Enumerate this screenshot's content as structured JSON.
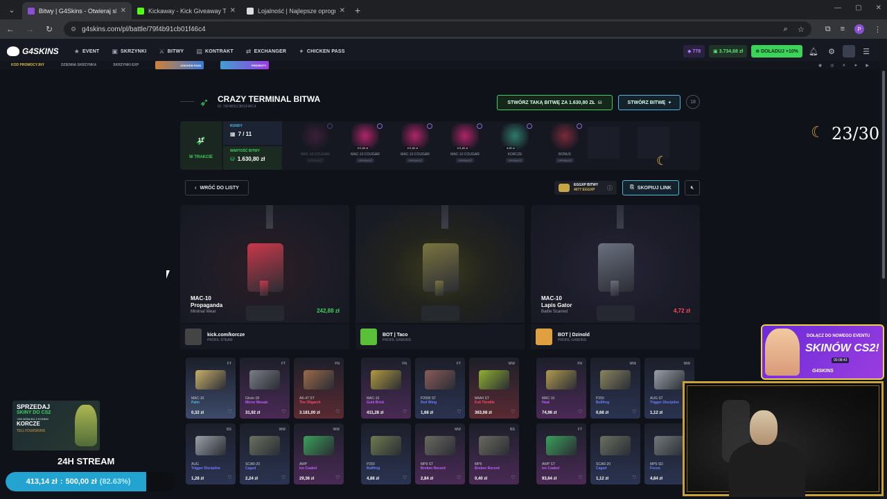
{
  "browser": {
    "tabs": [
      {
        "title": "Bitwy | G4Skins - Otwieraj skrzynki",
        "active": true,
        "color": "#8a4fd6"
      },
      {
        "title": "Kickaway - Kick Giveaway Tool",
        "active": false,
        "color": "#53fc18"
      },
      {
        "title": "Lojalność | Najlepsze oprogramowanie",
        "active": false,
        "color": "#dddddd"
      }
    ],
    "url": "g4skins.com/pl/battle/79f4b91cb01f46c4",
    "profile_initial": "P"
  },
  "header": {
    "logo": "G4SKINS",
    "nav": [
      {
        "label": "EVENT",
        "icon": "star-icon"
      },
      {
        "label": "SKRZYNKI",
        "icon": "box-icon"
      },
      {
        "label": "BITWY",
        "icon": "swords-icon"
      },
      {
        "label": "KONTRAKT",
        "icon": "contract-icon"
      },
      {
        "label": "EXCHANGER",
        "icon": "exchange-icon"
      },
      {
        "label": "CHICKEN PASS",
        "icon": "chicken-icon"
      }
    ],
    "points": "778",
    "balance": "3.734,68 zł",
    "topup_label": "DOŁADUJ +10%"
  },
  "subnav": {
    "items": [
      "KOD PROMOCYJNY",
      "DZIENNA SKRZYNKA",
      "SKRZYNKI EXP"
    ],
    "banner1": "CHICKEN PASS",
    "banner2": "PREZENTY"
  },
  "battle": {
    "title": "CRAZY TERMINAL BITWA",
    "id": "ID: 79F4B91CB01F46C4",
    "create_same_label": "STWÓRZ TAKĄ BITWĘ ZA 1.630,80 ZŁ",
    "create_label": "STWÓRZ BITWĘ",
    "age": "18",
    "status_count": "11",
    "status_label": "W TRAKCIE",
    "rounds_label": "RUNDY",
    "rounds_value": "7 / 11",
    "value_label": "WARTOŚĆ BITWY",
    "value_value": "1.630,80 zł",
    "rounds": [
      {
        "name": "MAC-10 COUGAR",
        "price": "",
        "btn": "SPRAWDŹ",
        "color": "#6a2a55",
        "faded": true
      },
      {
        "name": "MAC-10 COUGAR",
        "price": "101,60 zł",
        "btn": "SPRAWDŹ",
        "color": "#b0246a",
        "faded": false
      },
      {
        "name": "MAC-10 COUGAR",
        "price": "101,60 zł",
        "btn": "SPRAWDŹ",
        "color": "#b0246a",
        "faded": false
      },
      {
        "name": "MAC-10 COUGAR",
        "price": "101,60 zł",
        "btn": "SPRAWDŹ",
        "color": "#b0246a",
        "faded": false
      },
      {
        "name": "KORCZE",
        "price": "8,80 zł",
        "btn": "SPRAWDŹ",
        "color": "#2f7a6a",
        "faded": false
      },
      {
        "name": "BONUS",
        "price": "",
        "btn": "SPRAWDŹ",
        "color": "#7a2a3a",
        "faded": false
      }
    ],
    "back_label": "WRÓĆ DO LISTY",
    "eggxp_label": "EGGXP BITWY",
    "eggxp_value": "4077 EGGXP",
    "copy_label": "SKOPIUJ LINK"
  },
  "players": [
    {
      "drop": {
        "weapon": "MAC-10",
        "skin": "Propaganda",
        "wear": "Minimal Wear",
        "price": "242,88 zł",
        "price_color": "#3cd35a",
        "gun_color": "#c8384a",
        "bg": "red"
      },
      "name": "kick.com/korcze",
      "role": "PROFIL STEAM",
      "avatar": "#444",
      "items": [
        {
          "cond": "FT",
          "weapon": "MAC-10",
          "skin": "Palm",
          "price": "0,32 zł",
          "rarity": "#3d4a6a",
          "skin_color": "#4fb8e0",
          "img": "#c8b06a"
        },
        {
          "cond": "FT",
          "weapon": "Glock-18",
          "skin": "Mirror Mosaic",
          "price": "31,92 zł",
          "rarity": "#4a2a55",
          "skin_color": "#c060ff",
          "img": "#7a7d86"
        },
        {
          "cond": "FN",
          "weapon": "AK-47 ST",
          "skin": "The Oligarch",
          "price": "3.181,00 zł",
          "rarity": "#5a2a32",
          "skin_color": "#ff4a6a",
          "img": "#9a6a4a"
        },
        {
          "cond": "BS",
          "weapon": "AUG",
          "skin": "Trigger Discipline",
          "price": "1,28 zł",
          "rarity": "#2a3350",
          "skin_color": "#6a80ff",
          "img": "#9aa0a8"
        },
        {
          "cond": "WW",
          "weapon": "SCAR-20",
          "skin": "Caged",
          "price": "2,24 zł",
          "rarity": "#2a3350",
          "skin_color": "#6a80ff",
          "img": "#6a7060"
        },
        {
          "cond": "WW",
          "weapon": "AWP",
          "skin": "Ice Coaled",
          "price": "29,36 zł",
          "rarity": "#4a2a55",
          "skin_color": "#c060ff",
          "img": "#3aa05a"
        }
      ]
    },
    {
      "drop": {
        "weapon": "",
        "skin": "",
        "wear": "",
        "price": "",
        "price_color": "#fff",
        "gun_color": "#7a7440",
        "bg": "yellow"
      },
      "name": "BOT | Taco",
      "role": "PROFIL G4SKINS",
      "avatar": "#5ac03a",
      "items": [
        {
          "cond": "FN",
          "weapon": "MAC-10",
          "skin": "Gold Brick",
          "price": "411,28 zł",
          "rarity": "#4a2a55",
          "skin_color": "#c060ff",
          "img": "#b09a40"
        },
        {
          "cond": "FT",
          "weapon": "P2000 ST",
          "skin": "Red Wing",
          "price": "1,68 zł",
          "rarity": "#2a3350",
          "skin_color": "#6a80ff",
          "img": "#8a5a5a"
        },
        {
          "cond": "WW",
          "weapon": "M4A4 ST",
          "skin": "Full Throttle",
          "price": "363,08 zł",
          "rarity": "#5a2a32",
          "skin_color": "#ff4a6a",
          "img": "#90b030"
        },
        {
          "cond": "",
          "weapon": "P250",
          "skin": "Bullfrog",
          "price": "4,88 zł",
          "rarity": "#2a3350",
          "skin_color": "#6a80ff",
          "img": "#707a50"
        },
        {
          "cond": "MW",
          "weapon": "MP9 ST",
          "skin": "Broken Record",
          "price": "2,84 zł",
          "rarity": "#4a2a55",
          "skin_color": "#c060ff",
          "img": "#6a6a60"
        },
        {
          "cond": "BS",
          "weapon": "MP9",
          "skin": "Broken Record",
          "price": "0,40 zł",
          "rarity": "#4a2a55",
          "skin_color": "#c060ff",
          "img": "#6a6a60"
        }
      ]
    },
    {
      "drop": {
        "weapon": "MAC-10",
        "skin": "Lapis Gator",
        "wear": "Battle Scarred",
        "price": "4,72 zł",
        "price_color": "#ff4a5a",
        "gun_color": "#6a7080",
        "bg": "purple"
      },
      "name": "BOT | Dzinold",
      "role": "PROFIL G4SKINS",
      "avatar": "#e0a040",
      "items": [
        {
          "cond": "FN",
          "weapon": "MAC-10",
          "skin": "Heat",
          "price": "74,96 zł",
          "rarity": "#4a2a55",
          "skin_color": "#c060ff",
          "img": "#b09a50"
        },
        {
          "cond": "WW",
          "weapon": "P250",
          "skin": "Bullfrog",
          "price": "0,68 zł",
          "rarity": "#2a3350",
          "skin_color": "#6a80ff",
          "img": "#8a8460"
        },
        {
          "cond": "WW",
          "weapon": "AUG ST",
          "skin": "Trigger Discipline",
          "price": "1,12 zł",
          "rarity": "#2a3350",
          "skin_color": "#6a80ff",
          "img": "#9aa0a8"
        },
        {
          "cond": "FT",
          "weapon": "AWP ST",
          "skin": "Ice Coaled",
          "price": "93,64 zł",
          "rarity": "#4a2a55",
          "skin_color": "#c060ff",
          "img": "#3aa05a"
        },
        {
          "cond": "",
          "weapon": "SCAR-20",
          "skin": "Caged",
          "price": "1,12 zł",
          "rarity": "#2a3350",
          "skin_color": "#6a80ff",
          "img": "#6a7060"
        },
        {
          "cond": "",
          "weapon": "MP5-SD",
          "skin": "Focus",
          "price": "4,84 zł",
          "rarity": "#2a3350",
          "skin_color": "#6a80ff",
          "img": "#70787a"
        }
      ]
    }
  ],
  "overlay": {
    "promo_line1": "SPRZEDAJ",
    "promo_line2": "SKINY DO CS2",
    "promo_line3": "+6% BONUSU Z KODEM",
    "promo_line4": "KORCZE",
    "promo_line5": "TELLYOURSKINS",
    "stream_label": "24H STREAM",
    "goal_current": "413,14 zł",
    "goal_sep": ":",
    "goal_target": "500,00 zł",
    "goal_percent": "(82.63%)",
    "goal_fraction": 0.8263,
    "counter": "23/30",
    "event_line1": "DOŁĄCZ DO NOWEGO EVENTU",
    "event_line2": "SKINÓW CS2!",
    "event_timer": "00:08:43",
    "event_logo": "G4SKINS"
  }
}
